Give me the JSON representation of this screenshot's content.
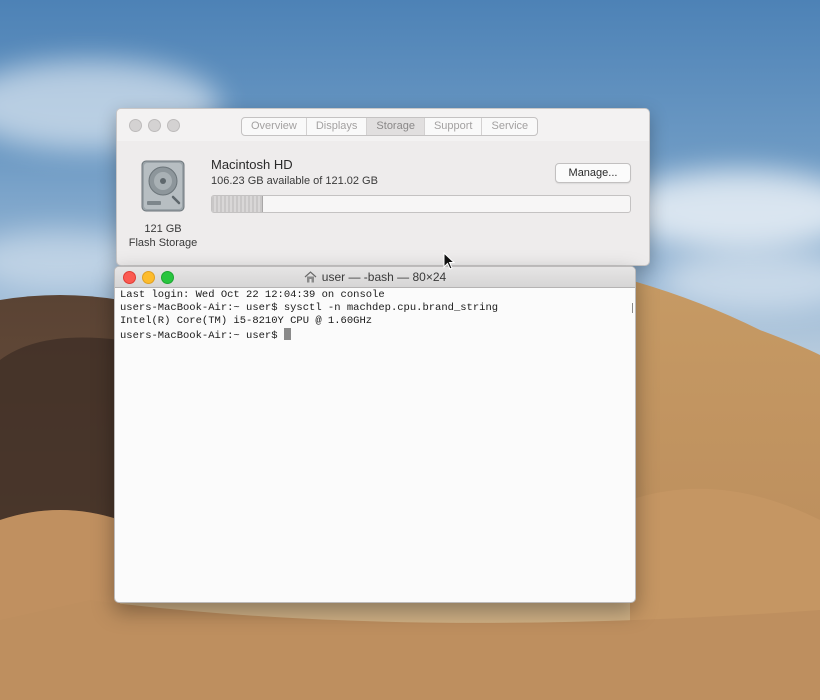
{
  "storage_window": {
    "tabs": [
      {
        "label": "Overview"
      },
      {
        "label": "Displays"
      },
      {
        "label": "Storage"
      },
      {
        "label": "Support"
      },
      {
        "label": "Service"
      }
    ],
    "active_tab": "Storage",
    "disk": {
      "name": "Macintosh HD",
      "available_text": "106.23 GB available of 121.02 GB",
      "capacity_label": "121 GB",
      "type_label": "Flash Storage",
      "used_fraction": 0.12
    },
    "manage_button_label": "Manage..."
  },
  "terminal_window": {
    "title": "user — -bash — 80×24",
    "lines": [
      "Last login: Wed Oct 22 12:04:39 on console",
      "users-MacBook-Air:~ user$ sysctl -n machdep.cpu.brand_string",
      "Intel(R) Core(TM) i5-8210Y CPU @ 1.60GHz",
      "users-MacBook-Air:~ user$ "
    ]
  },
  "colors": {
    "close": "#fb5a52",
    "minimize": "#fdbc2d",
    "maximize": "#29c53f"
  },
  "icons": {
    "disk": "hard-drive-icon",
    "home": "home-icon",
    "pointer": "mouse-pointer-icon"
  }
}
